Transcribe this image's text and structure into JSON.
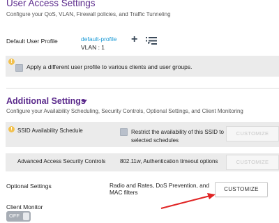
{
  "user_access": {
    "title": "User Access Settings",
    "subtitle": "Configure your QoS, VLAN, Firewall policies, and Traffic Tunneling",
    "default_profile_label": "Default User Profile",
    "default_profile_value": "default-profile",
    "vlan_text": "VLAN : 1",
    "add_icon": "plus-icon",
    "list_icon": "list-icon",
    "apply_profile_text": "Apply a different user profile to various clients and user groups.",
    "apply_profile_checked": false
  },
  "additional": {
    "title": "Additional Settings",
    "subtitle": "Configure your Availability Scheduling, Security Controls, Optional Settings, and Client Monitoring",
    "ssid_schedule": {
      "label": "SSID Availability Schedule",
      "checkbox_text": "Restrict the availability of this SSID to selected schedules",
      "checked": false,
      "button_label": "CUSTOMIZE"
    },
    "security_controls": {
      "label": "Advanced Access Security Controls",
      "description": "802.11w, Authentication timeout options",
      "button_label": "CUSTOMIZE"
    },
    "optional_settings": {
      "label": "Optional Settings",
      "description": "Radio and Rates, DoS Prevention, and MAC filters",
      "button_label": "CUSTOMIZE"
    },
    "client_monitor": {
      "label": "Client Monitor",
      "toggle_state": "OFF"
    }
  },
  "colors": {
    "heading": "#5b2a8c",
    "link": "#1a9ad6",
    "panel_bg": "#ebebeb",
    "info_icon": "#f2c14e",
    "annotation_arrow": "#e02424"
  }
}
